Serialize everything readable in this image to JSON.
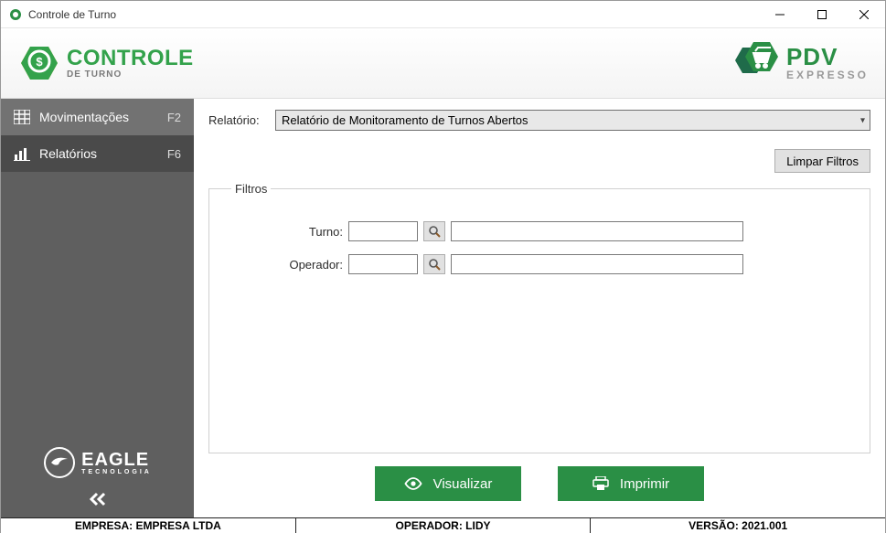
{
  "window": {
    "title": "Controle de Turno"
  },
  "header": {
    "brand_left_line1": "CONTROLE",
    "brand_left_line2": "DE TURNO",
    "brand_right_line1": "PDV",
    "brand_right_line2": "EXPRESSO"
  },
  "sidebar": {
    "items": [
      {
        "label": "Movimentações",
        "shortcut": "F2"
      },
      {
        "label": "Relatórios",
        "shortcut": "F6"
      }
    ],
    "eagle_line1": "EAGLE",
    "eagle_line2": "TECNOLOGIA"
  },
  "main": {
    "report_label": "Relatório:",
    "report_selected": "Relatório de Monitoramento de Turnos Abertos",
    "clear_filters_label": "Limpar Filtros",
    "filters_legend": "Filtros",
    "filters": {
      "turno_label": "Turno:",
      "turno_code": "",
      "turno_desc": "",
      "operador_label": "Operador:",
      "operador_code": "",
      "operador_desc": ""
    },
    "visualize_label": "Visualizar",
    "print_label": "Imprimir"
  },
  "status": {
    "company_label": "EMPRESA: EMPRESA LTDA",
    "operator_label": "OPERADOR: LIDY",
    "version_label": "VERSÃO: 2021.001"
  }
}
